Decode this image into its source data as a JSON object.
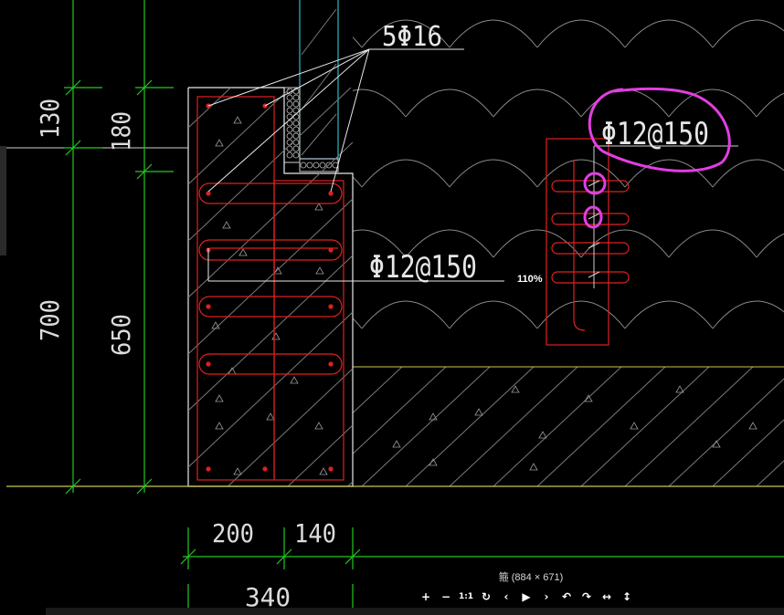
{
  "drawing": {
    "rebar_top_label": "5Φ16",
    "stirrup_label_main": "Φ12@150",
    "stirrup_label_detail": "Φ12@150",
    "dim_left_outer": [
      "130",
      "700"
    ],
    "dim_left_inner": [
      "180",
      "650"
    ],
    "dim_bottom_parts": [
      "200",
      "140"
    ],
    "dim_bottom_total": "340"
  },
  "viewer": {
    "zoom": "110%",
    "caption": "箍 (884 × 671)",
    "toolbar": [
      {
        "name": "zoom-in-button",
        "icon": "plus-icon",
        "glyph": "+"
      },
      {
        "name": "zoom-out-button",
        "icon": "minus-icon",
        "glyph": "−"
      },
      {
        "name": "actual-size-button",
        "icon": "one-to-one-icon",
        "glyph": "1:1"
      },
      {
        "name": "refresh-button",
        "icon": "refresh-icon",
        "glyph": "↻"
      },
      {
        "name": "previous-button",
        "icon": "chevron-left-icon",
        "glyph": "‹"
      },
      {
        "name": "play-button",
        "icon": "play-icon",
        "glyph": "▶"
      },
      {
        "name": "next-button",
        "icon": "chevron-right-icon",
        "glyph": "›"
      },
      {
        "name": "rotate-left-button",
        "icon": "rotate-left-icon",
        "glyph": "↶"
      },
      {
        "name": "rotate-right-button",
        "icon": "rotate-right-icon",
        "glyph": "↷"
      },
      {
        "name": "flip-horizontal-button",
        "icon": "flip-horizontal-icon",
        "glyph": "↔"
      },
      {
        "name": "flip-vertical-button",
        "icon": "flip-vertical-icon",
        "glyph": "↕"
      }
    ]
  },
  "colors": {
    "background": "#000000",
    "dimension": "#22c922",
    "rebar": "#e02020",
    "outline": "#e8e8e8",
    "ground": "#c8c850",
    "annotation": "#e23ee2",
    "wall": "#2fb8c8"
  }
}
